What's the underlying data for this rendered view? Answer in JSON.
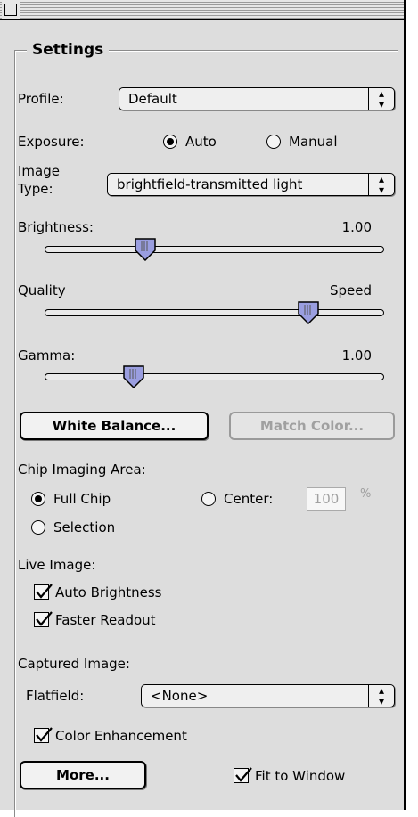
{
  "window": {
    "title": ""
  },
  "settings": {
    "title": "Settings",
    "profile": {
      "label": "Profile:",
      "value": "Default"
    },
    "exposure": {
      "label": "Exposure:",
      "auto": "Auto",
      "manual": "Manual",
      "selected": "Auto"
    },
    "image_type": {
      "label_line1": "Image",
      "label_line2": "Type:",
      "value": "brightfield-transmitted light"
    },
    "brightness": {
      "label": "Brightness:",
      "value": "1.00",
      "position": 0.28
    },
    "quality_speed": {
      "left_label": "Quality",
      "right_label": "Speed",
      "position": 0.78
    },
    "gamma": {
      "label": "Gamma:",
      "value": "1.00",
      "position": 0.22
    },
    "white_balance_button": "White Balance...",
    "match_color_button": "Match Color...",
    "chip_area": {
      "label": "Chip Imaging Area:",
      "full_chip": "Full Chip",
      "center": "Center:",
      "center_value": "100",
      "center_unit": "%",
      "selection": "Selection",
      "selected": "Full Chip"
    },
    "live_image": {
      "label": "Live Image:",
      "auto_brightness": {
        "label": "Auto Brightness",
        "checked": true
      },
      "faster_readout": {
        "label": "Faster Readout",
        "checked": true
      }
    },
    "captured_image": {
      "label": "Captured Image:",
      "flatfield_label": "Flatfield:",
      "flatfield_value": "<None>",
      "color_enhancement": {
        "label": "Color Enhancement",
        "checked": true
      }
    },
    "more_button": "More...",
    "fit_to_window": {
      "label": "Fit to Window",
      "checked": true
    }
  },
  "icons": {
    "popup_arrows": "updown-arrows-icon",
    "checkmark": "checkmark-icon",
    "slider_thumb": "slider-thumb-icon"
  }
}
